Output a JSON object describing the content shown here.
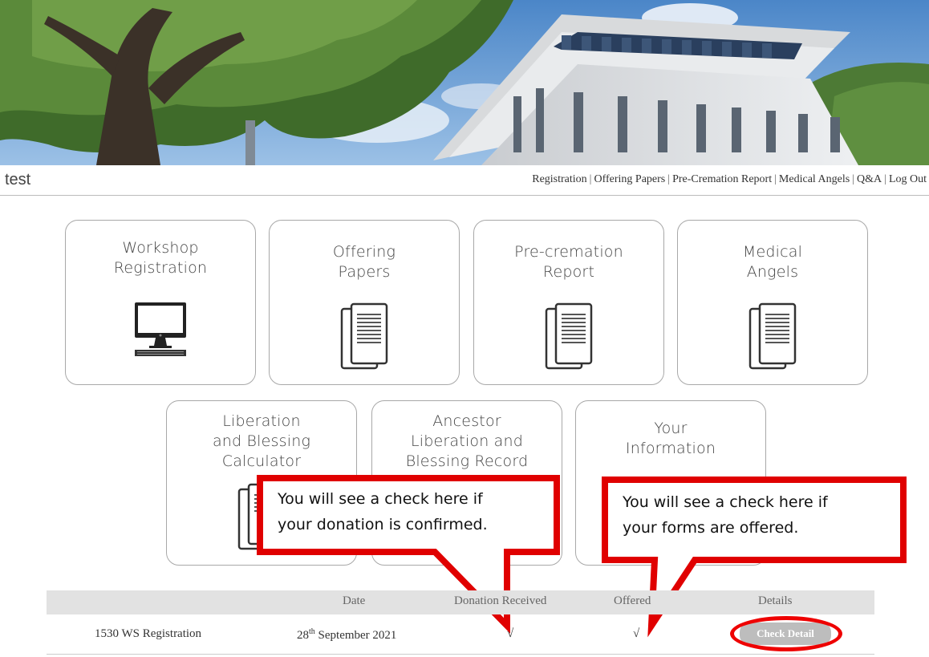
{
  "header": {
    "user_name": "test"
  },
  "nav": {
    "items": [
      {
        "label": "Registration"
      },
      {
        "label": "Offering Papers"
      },
      {
        "label": "Pre-Cremation Report"
      },
      {
        "label": "Medical Angels"
      },
      {
        "label": "Q&A"
      },
      {
        "label": "Log Out"
      }
    ],
    "separator": "|"
  },
  "tiles": {
    "workshop": {
      "label": "Workshop\nRegistration",
      "icon": "computer-icon"
    },
    "offering": {
      "label": "Offering\nPapers",
      "icon": "documents-icon"
    },
    "precremation": {
      "label": "Pre-cremation\nReport",
      "icon": "documents-icon"
    },
    "medical": {
      "label": "Medical\nAngels",
      "icon": "documents-icon"
    },
    "calculator": {
      "label": "Liberation\nand Blessing\nCalculator",
      "icon": "documents-icon"
    },
    "ancestor": {
      "label": "Ancestor\nLiberation and\nBlessing Record",
      "icon": "documents-icon"
    },
    "info": {
      "label": "Your\nInformation"
    }
  },
  "callouts": {
    "donation": "You will see a check here if\nyour donation is confirmed.",
    "offered": "You will see a check here if\nyour forms are offered."
  },
  "table": {
    "headers": {
      "date": "Date",
      "donation": "Donation Received",
      "offered": "Offered",
      "details": "Details"
    },
    "rows": [
      {
        "name": "1530 WS Registration",
        "date_day": "28",
        "date_suffix": "th",
        "date_rest": " September 2021",
        "donation_check": "√",
        "offered_check": "√",
        "button": "Check Detail"
      }
    ]
  },
  "colors": {
    "callout_border": "#e00000",
    "tile_border": "#a8a8a8",
    "button_bg": "#bdbdbd"
  }
}
